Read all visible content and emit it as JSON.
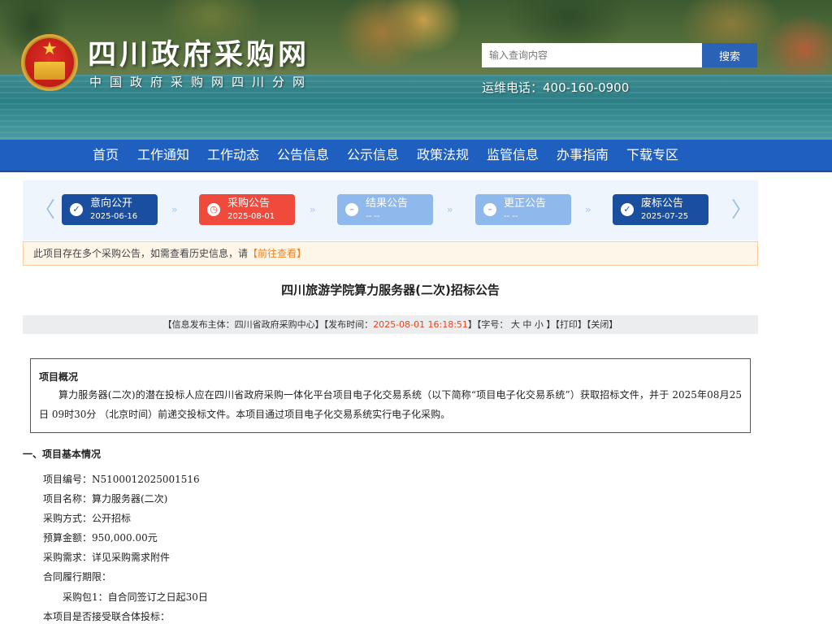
{
  "header": {
    "site_title": "四川政府采购网",
    "site_subtitle": "中国政府采购网四川分网",
    "search_placeholder": "输入查询内容",
    "search_button": "搜索",
    "hotline": "运维电话：400-160-0900",
    "emblem_star": "★"
  },
  "nav": {
    "items": [
      "首页",
      "工作通知",
      "工作动态",
      "公告信息",
      "公示信息",
      "政策法规",
      "监管信息",
      "办事指南",
      "下载专区"
    ]
  },
  "steps": {
    "prev_arrow": "〈",
    "next_arrow": "〉",
    "separator": "››",
    "items": [
      {
        "label": "意向公开",
        "date": "2025-06-16",
        "status": "done",
        "icon": "✓"
      },
      {
        "label": "采购公告",
        "date": "2025-08-01",
        "status": "current",
        "icon": "◷"
      },
      {
        "label": "结果公告",
        "date": "-- --",
        "status": "pending",
        "icon": "–"
      },
      {
        "label": "更正公告",
        "date": "-- --",
        "status": "pending",
        "icon": "–"
      },
      {
        "label": "废标公告",
        "date": "2025-07-25",
        "status": "done",
        "icon": "✓"
      }
    ]
  },
  "notice": {
    "text": "此项目存在多个采购公告，如需查看历史信息，请",
    "link": "【前往查看】"
  },
  "article": {
    "title": "四川旅游学院算力服务器(二次)招标公告",
    "meta_prefix": "【信息发布主体：四川省政府采购中心】【发布时间：",
    "meta_time": "2025-08-01 16:18:51",
    "meta_font": "】【字号： 大 中 小 】",
    "meta_print": "【打印】",
    "meta_close": "【关闭】"
  },
  "overview": {
    "title": "项目概况",
    "text": "算力服务器(二次)的潜在投标人应在四川省政府采购一体化平台项目电子化交易系统（以下简称“项目电子化交易系统”）获取招标文件，并于 2025年08月25日 09时30分 （北京时间）前递交投标文件。本项目通过项目电子化交易系统实行电子化采购。"
  },
  "section1": {
    "heading": "一、项目基本情况",
    "lines": [
      "项目编号：N5100012025001516",
      "项目名称：算力服务器(二次)",
      "采购方式：公开招标",
      "预算金额：950,000.00元",
      "采购需求：详见采购需求附件",
      "合同履行期限：",
      "采购包1：自合同签订之日起30日",
      "本项目是否接受联合体投标："
    ]
  },
  "colors": {
    "nav_bg": "#1f5fbf",
    "step_done": "#1a4f9f",
    "step_current": "#ef4a3c",
    "step_pending": "#8fb8ec",
    "accent_orange": "#e8862a",
    "time_red": "#e8451e"
  }
}
